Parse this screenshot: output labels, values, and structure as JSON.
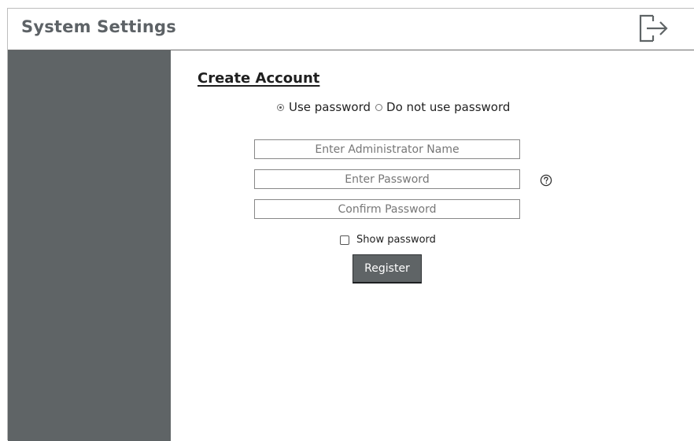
{
  "header": {
    "title": "System Settings",
    "logout_icon": "logout-icon"
  },
  "form": {
    "title": "Create Account",
    "password_mode": {
      "options": [
        "Use password",
        "Do not use password"
      ],
      "selected": "Use password"
    },
    "admin_name": {
      "placeholder": "Enter Administrator Name",
      "value": ""
    },
    "password": {
      "placeholder": "Enter Password",
      "value": ""
    },
    "confirm_password": {
      "placeholder": "Confirm Password",
      "value": ""
    },
    "help_icon": "help-icon",
    "show_password": {
      "label": "Show password",
      "checked": false
    },
    "register_label": "Register"
  },
  "colors": {
    "sidebar": "#5f6466",
    "button": "#5f6466",
    "title_text": "#5d6266"
  }
}
